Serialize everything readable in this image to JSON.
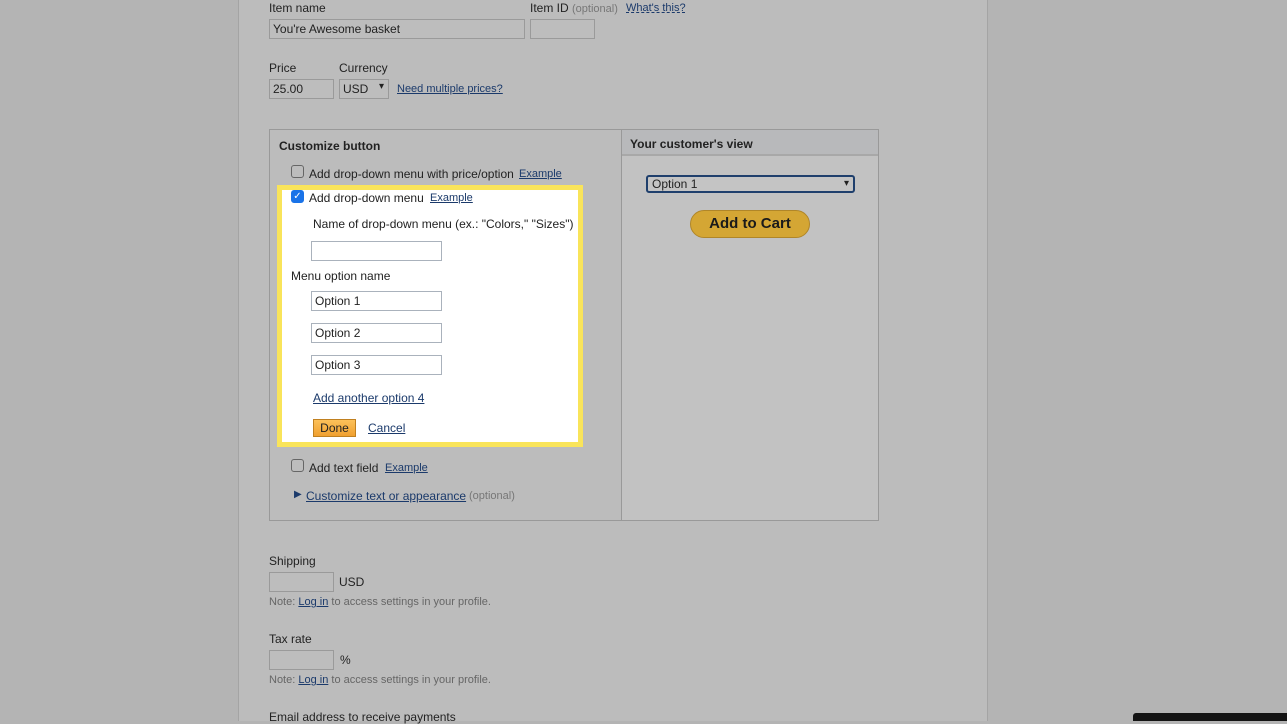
{
  "item": {
    "name_label": "Item name",
    "name_value": "You're Awesome basket",
    "id_label": "Item ID",
    "id_optional": "(optional)",
    "whats_this": "What's this?",
    "id_value": ""
  },
  "price": {
    "label": "Price",
    "value": "25.00",
    "currency_label": "Currency",
    "currency_value": "USD",
    "multiple_link": "Need multiple prices?"
  },
  "customize": {
    "title": "Customize button",
    "dropdown_price_label": "Add drop-down menu with price/option",
    "dropdown_price_checked": false,
    "dropdown_label": "Add drop-down menu",
    "dropdown_checked": true,
    "example": "Example",
    "menu_name_label": "Name of drop-down menu (ex.: \"Colors,\" \"Sizes\")",
    "menu_name_value": "",
    "option_name_label": "Menu option name",
    "options": [
      "Option 1",
      "Option 2",
      "Option 3"
    ],
    "add_option": "Add another option 4",
    "done": "Done",
    "cancel": "Cancel",
    "text_field_label": "Add text field",
    "text_field_checked": false,
    "appearance_link": "Customize text or appearance",
    "appearance_optional": "(optional)"
  },
  "preview": {
    "title": "Your customer's view",
    "select_value": "Option 1",
    "cart_button": "Add to Cart"
  },
  "shipping": {
    "label": "Shipping",
    "unit": "USD",
    "note_prefix": "Note:",
    "login": "Log in",
    "note_suffix": "to access settings in your profile."
  },
  "tax": {
    "label": "Tax rate",
    "unit": "%",
    "note_prefix": "Note:",
    "login": "Log in",
    "note_suffix": "to access settings in your profile."
  },
  "email": {
    "label": "Email address to receive payments"
  },
  "colors": {
    "highlight": "#f9e45a",
    "done_button": "#f0a030",
    "cart_button": "#d4a634",
    "link": "#1b3a6b"
  }
}
